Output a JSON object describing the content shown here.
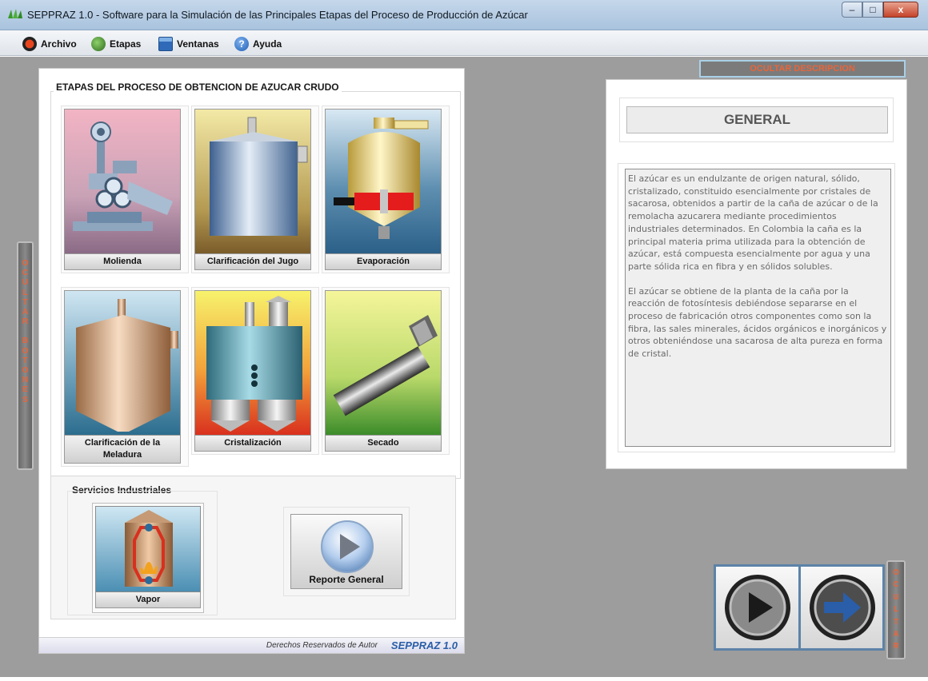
{
  "window": {
    "title": "SEPPRAZ 1.0  -  Software para la Simulación de las Principales Etapas del Proceso de Producción de Azúcar",
    "minimize": "–",
    "maximize": "□",
    "close": "x"
  },
  "menu": {
    "items": [
      {
        "label": "Archivo",
        "icon": "record-icon"
      },
      {
        "label": "Etapas",
        "icon": "leaf-icon"
      },
      {
        "label": "Ventanas",
        "icon": "window-icon"
      },
      {
        "label": "Ayuda",
        "icon": "help-icon"
      }
    ]
  },
  "stages": {
    "title": "ETAPAS DEL PROCESO DE OBTENCION DE AZUCAR CRUDO",
    "tiles": [
      {
        "label": "Molienda",
        "icon": "mill-icon"
      },
      {
        "label": "Clarificación del Jugo",
        "icon": "clarifier-tank-icon"
      },
      {
        "label": "Evaporación",
        "icon": "evaporator-icon"
      },
      {
        "label": "Clarificación de la Meladura",
        "icon": "meladura-tank-icon"
      },
      {
        "label": "Cristalización",
        "icon": "crystallizer-icon"
      },
      {
        "label": "Secado",
        "icon": "dryer-icon"
      }
    ]
  },
  "services": {
    "title": "Servicios Industriales",
    "vapor_label": "Vapor",
    "report_label": "Reporte General"
  },
  "footer": {
    "copyright": "Derechos Reservados de Autor",
    "brand": "SEPPRAZ 1.0"
  },
  "side_buttons": {
    "hide_buttons": [
      "O",
      "C",
      "U",
      "L",
      "T",
      "A",
      "R",
      "",
      "B",
      "O",
      "T",
      "O",
      "N",
      "E",
      "S"
    ],
    "hide": [
      "O",
      "C",
      "U",
      "L",
      "T",
      "A",
      "R"
    ]
  },
  "description": {
    "toggle_label": "OCULTAR DESCRIPCION",
    "heading": "GENERAL",
    "paragraphs": [
      "El azúcar es un endulzante de origen natural, sólido, cristalizado, constituido esencialmente por cristales de sacarosa, obtenidos a partir de la caña de azúcar o de la remolacha azucarera mediante procedimientos industriales determinados. En Colombia la caña es la principal materia prima utilizada para la obtención de azúcar, está compuesta esencialmente por agua y una parte sólida rica en fibra y en sólidos solubles.",
      "El azúcar se obtiene de la planta de la caña por la reacción de fotosíntesis debiéndose separarse en el proceso de fabricación otros componentes como son la fibra, las sales minerales, ácidos orgánicos e inorgánicos y otros obteniéndose una sacarosa de alta pureza en forma de cristal."
    ]
  },
  "colors": {
    "accent_orange": "#e8653a",
    "brand_blue": "#2a5ea8",
    "workspace_gray": "#9d9d9d"
  }
}
